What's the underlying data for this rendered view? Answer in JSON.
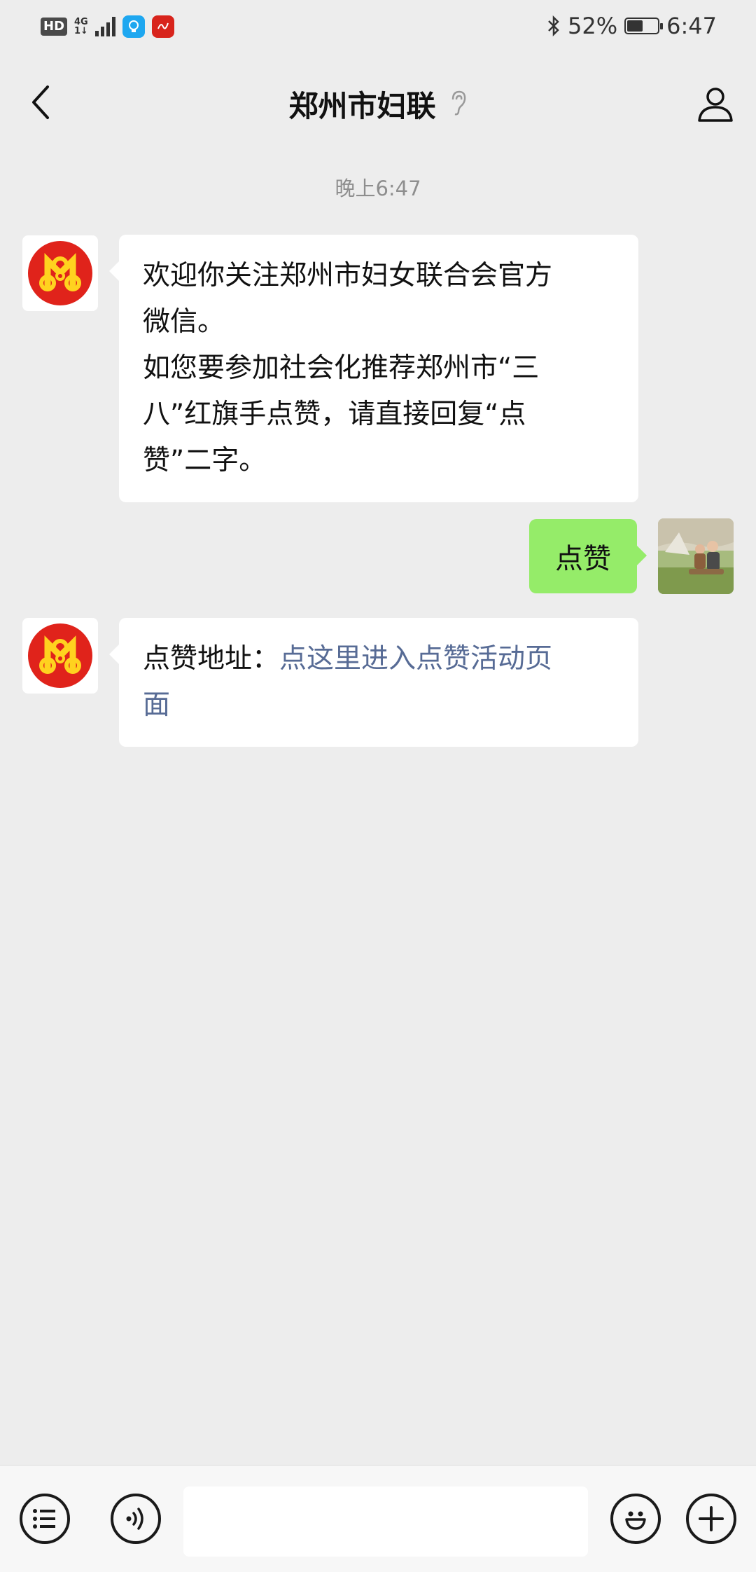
{
  "status_bar": {
    "hd": "HD",
    "network": "4G",
    "network_sub": "1↓",
    "battery": "52%",
    "battery_level": 0.52,
    "time": "6:47"
  },
  "header": {
    "title": "郑州市妇联",
    "back_icon": "chevron-left-icon",
    "ear_icon": "ear-icon",
    "profile_icon": "person-icon"
  },
  "chat": {
    "time_separator": "晚上6:47",
    "messages": [
      {
        "sender": "official",
        "lines": [
          "欢迎你关注郑州市妇女联合会官方",
          "微信。",
          "如您要参加社会化推荐郑州市“三",
          "八”红旗手点赞，请直接回复“点",
          "赞”二字。"
        ]
      },
      {
        "sender": "me",
        "text": "点赞"
      },
      {
        "sender": "official",
        "label": "点赞地址：",
        "link_line1": "点这里进入点赞活动页",
        "link_line2": "面"
      }
    ]
  },
  "input_bar": {
    "menu_icon": "list-menu-icon",
    "voice_icon": "voice-icon",
    "emoji_icon": "emoji-icon",
    "plus_icon": "plus-icon",
    "placeholder": ""
  },
  "colors": {
    "background": "#ededed",
    "incoming_bubble": "#ffffff",
    "outgoing_bubble": "#95ec69",
    "link": "#576b95",
    "logo_red": "#e0231b",
    "logo_yellow": "#ffd21f"
  }
}
